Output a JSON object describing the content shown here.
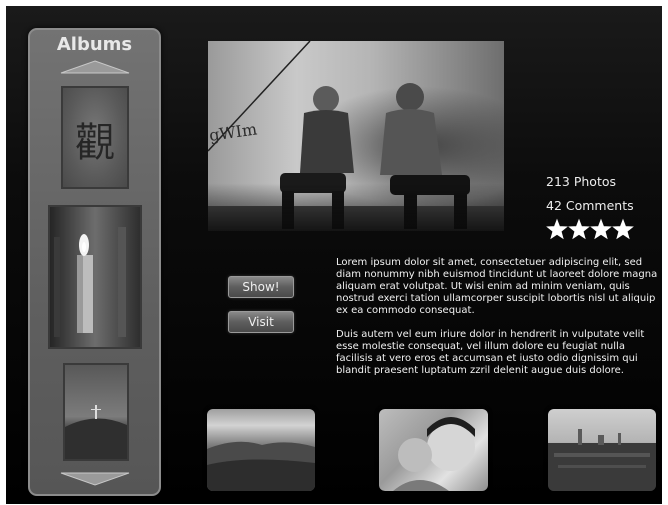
{
  "sidebar": {
    "title": "Albums",
    "up_icon": "chevron-up-icon",
    "down_icon": "chevron-down-icon",
    "albums": [
      {
        "glyph": "觀"
      }
    ]
  },
  "stats": {
    "photos": "213 Photos",
    "comments": "42 Comments",
    "rating": 4,
    "rating_max": 4,
    "star_color": "#ffffff"
  },
  "buttons": {
    "show": "Show!",
    "visit": "Visit"
  },
  "description": {
    "paragraph1": "Lorem ipsum dolor sit amet, consectetuer adipiscing elit, sed diam nonummy nibh euismod tincidunt ut laoreet dolore magna aliquam erat volutpat. Ut wisi enim ad minim veniam, quis nostrud exerci tation ullamcorper suscipit lobortis nisl ut aliquip ex ea commodo consequat.",
    "paragraph2": "Duis autem vel eum iriure dolor in hendrerit in vulputate velit esse molestie consequat, vel illum dolore eu feugiat nulla facilisis at vero eros et accumsan et iusto odio dignissim qui blandit praesent luptatum zzril delenit augue duis dolore."
  },
  "colors": {
    "background": "#000000",
    "panel": "#656565",
    "text": "#f2f2f2"
  }
}
